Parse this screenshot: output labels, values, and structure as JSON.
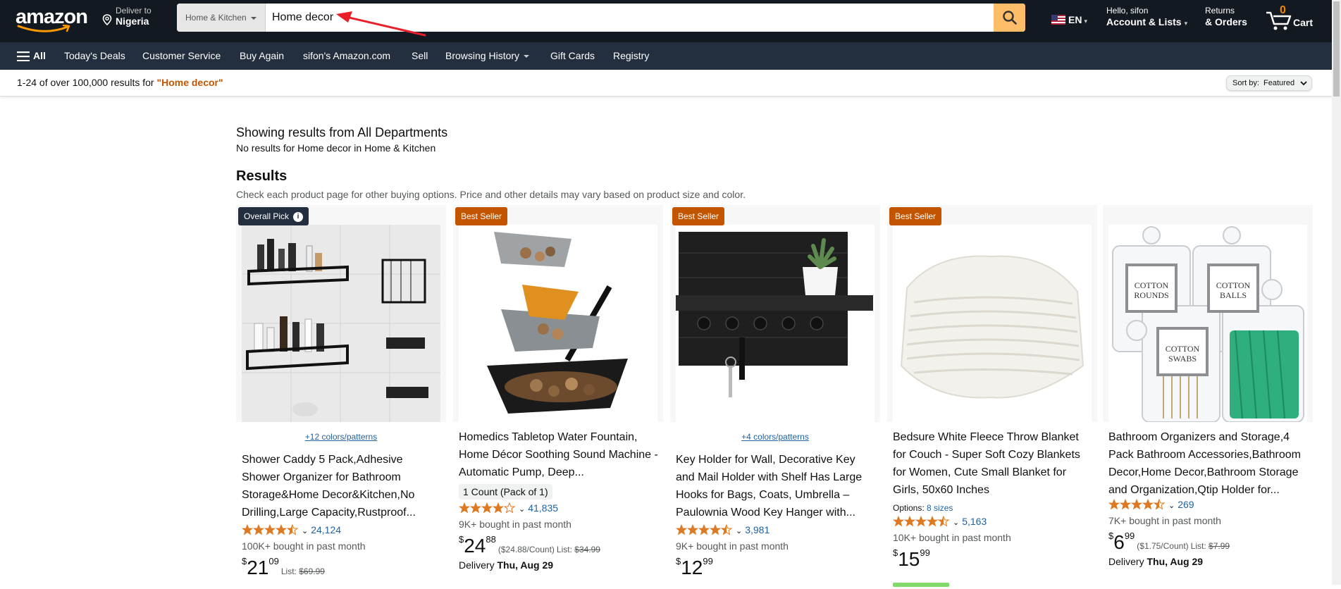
{
  "header": {
    "logo_text": "amazon",
    "deliver_line1": "Deliver to",
    "deliver_line2": "Nigeria",
    "search_dept": "Home & Kitchen",
    "search_value": "Home decor",
    "language": "EN",
    "account_line1": "Hello, sifon",
    "account_line2": "Account & Lists",
    "orders_line1": "Returns",
    "orders_line2": "& Orders",
    "cart_count": "0",
    "cart_label": "Cart"
  },
  "subnav": {
    "all": "All",
    "items": [
      "Today's Deals",
      "Customer Service",
      "Buy Again",
      "sifon's Amazon.com",
      "Sell",
      "Browsing History",
      "Gift Cards",
      "Registry"
    ]
  },
  "results_bar": {
    "count_text": "1-24 of over 100,000 results for ",
    "query": "\"Home decor\"",
    "sort_label": "Sort by:",
    "sort_value": "Featured"
  },
  "main": {
    "showing_from": "Showing results from All Departments",
    "no_results": "No results for Home decor in Home & Kitchen",
    "results_heading": "Results",
    "results_note": "Check each product page for other buying options. Price and other details may vary based on product size and color."
  },
  "products": [
    {
      "badge": "Overall Pick",
      "colors": "+12 colors/patterns",
      "title": "Shower Caddy 5 Pack,Adhesive Shower Organizer for Bathroom Storage&Home Decor&Kitchen,No Drilling,Large Capacity,Rustproof...",
      "rating_count": "24,124",
      "bought": "100K+ bought in past month",
      "price_symbol": "$",
      "price_whole": "21",
      "price_fraction": "09",
      "list_label": "List:",
      "list_price": "$69.99"
    },
    {
      "badge": "Best Seller",
      "title": "Homedics Tabletop Water Fountain, Home Décor Soothing Sound Machine - Automatic Pump, Deep...",
      "pill": "1 Count (Pack of 1)",
      "rating_count": "41,835",
      "bought": "9K+ bought in past month",
      "price_symbol": "$",
      "price_whole": "24",
      "price_fraction": "88",
      "unit_price": "($24.88/Count)",
      "list_label": "List:",
      "list_price": "$34.99",
      "delivery_label": "Delivery",
      "delivery_date": "Thu, Aug 29"
    },
    {
      "badge": "Best Seller",
      "colors": "+4 colors/patterns",
      "title": "Key Holder for Wall, Decorative Key and Mail Holder with Shelf Has Large Hooks for Bags, Coats, Umbrella – Paulownia Wood Key Hanger with...",
      "rating_count": "3,981",
      "bought": "9K+ bought in past month",
      "price_symbol": "$",
      "price_whole": "12",
      "price_fraction": "99"
    },
    {
      "badge": "Best Seller",
      "title": "Bedsure White Fleece Throw Blanket for Couch - Super Soft Cozy Blankets for Women, Cute Small Blanket for Girls, 50x60 Inches",
      "options_label": "Options:",
      "options_link": "8 sizes",
      "rating_count": "5,163",
      "bought": "10K+ bought in past month",
      "price_symbol": "$",
      "price_whole": "15",
      "price_fraction": "99"
    },
    {
      "title": "Bathroom Organizers and Storage,4 Pack Bathroom Accessories,Bathroom Decor,Home Decor,Bathroom Storage and Organization,Qtip Holder for...",
      "rating_count": "269",
      "bought": "7K+ bought in past month",
      "price_symbol": "$",
      "price_whole": "6",
      "price_fraction": "99",
      "unit_price": "($1.75/Count)",
      "list_label": "List:",
      "list_price": "$7.99",
      "delivery_label": "Delivery",
      "delivery_date": "Thu, Aug 29",
      "jar_labels": [
        "COTTON ROUNDS",
        "COTTON BALLS",
        "COTTON SWABS"
      ]
    }
  ],
  "colors": {
    "nav_bg": "#131921",
    "subnav_bg": "#232f3e",
    "search_button": "#febd69",
    "badge_best": "#c45500",
    "badge_pick": "#232f3e",
    "link": "#2162a1",
    "star": "#de7921",
    "query": "#c45500",
    "annotation_arrow": "#e8202a"
  }
}
